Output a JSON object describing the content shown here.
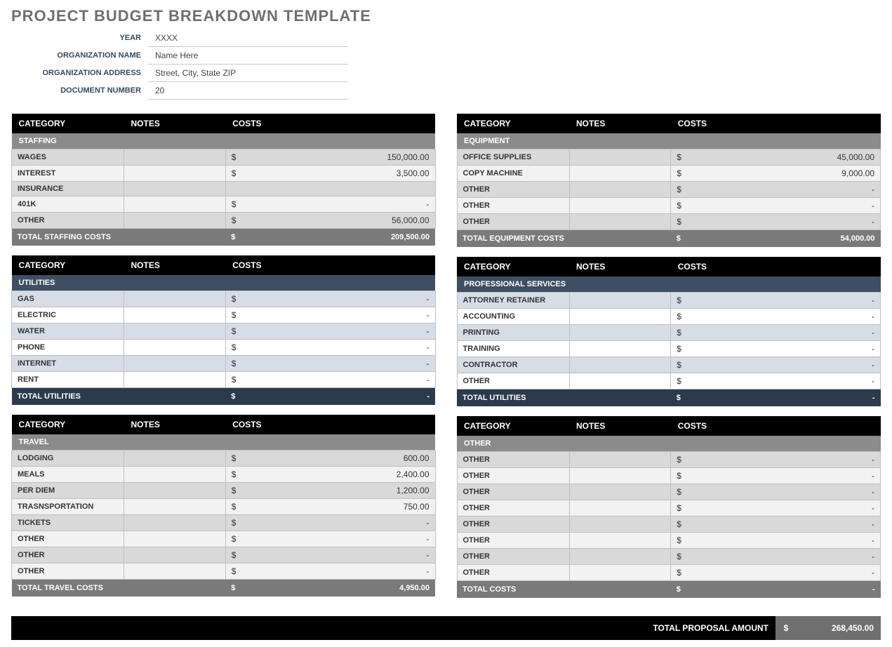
{
  "title": "PROJECT BUDGET BREAKDOWN TEMPLATE",
  "meta": {
    "year_label": "YEAR",
    "year_value": "XXXX",
    "org_name_label": "ORGANIZATION NAME",
    "org_name_value": "Name Here",
    "org_addr_label": "ORGANIZATION ADDRESS",
    "org_addr_value": "Street, City, State ZIP",
    "doc_num_label": "DOCUMENT NUMBER",
    "doc_num_value": "20"
  },
  "headers": {
    "category": "CATEGORY",
    "notes": "NOTES",
    "costs": "COSTS"
  },
  "currency": "$",
  "left": [
    {
      "style": "grey",
      "section": "STAFFING",
      "rows": [
        {
          "cat": "WAGES",
          "notes": "",
          "amt": "150,000.00"
        },
        {
          "cat": "INTEREST",
          "notes": "",
          "amt": "3,500.00"
        },
        {
          "cat": "INSURANCE",
          "notes": "",
          "amt": ""
        },
        {
          "cat": "401K",
          "notes": "",
          "amt": "-"
        },
        {
          "cat": "OTHER",
          "notes": "",
          "amt": "56,000.00"
        }
      ],
      "total_label": "TOTAL STAFFING COSTS",
      "total_amt": "209,500.00"
    },
    {
      "style": "blue",
      "section": "UTILITIES",
      "rows": [
        {
          "cat": "GAS",
          "notes": "",
          "amt": "-"
        },
        {
          "cat": "ELECTRIC",
          "notes": "",
          "amt": "-"
        },
        {
          "cat": "WATER",
          "notes": "",
          "amt": "-"
        },
        {
          "cat": "PHONE",
          "notes": "",
          "amt": "-"
        },
        {
          "cat": "INTERNET",
          "notes": "",
          "amt": "-"
        },
        {
          "cat": "RENT",
          "notes": "",
          "amt": "-"
        }
      ],
      "total_label": "TOTAL UTILITIES",
      "total_amt": "-"
    },
    {
      "style": "grey",
      "section": "TRAVEL",
      "rows": [
        {
          "cat": "LODGING",
          "notes": "",
          "amt": "600.00"
        },
        {
          "cat": "MEALS",
          "notes": "",
          "amt": "2,400.00"
        },
        {
          "cat": "PER DIEM",
          "notes": "",
          "amt": "1,200.00"
        },
        {
          "cat": "TRASNSPORTATION",
          "notes": "",
          "amt": "750.00"
        },
        {
          "cat": "TICKETS",
          "notes": "",
          "amt": "-"
        },
        {
          "cat": "OTHER",
          "notes": "",
          "amt": "-"
        },
        {
          "cat": "OTHER",
          "notes": "",
          "amt": "-"
        },
        {
          "cat": "OTHER",
          "notes": "",
          "amt": "-"
        }
      ],
      "total_label": "TOTAL TRAVEL COSTS",
      "total_amt": "4,950.00"
    }
  ],
  "right": [
    {
      "style": "grey",
      "section": "EQUIPMENT",
      "rows": [
        {
          "cat": "OFFICE SUPPLIES",
          "notes": "",
          "amt": "45,000.00"
        },
        {
          "cat": "COPY MACHINE",
          "notes": "",
          "amt": "9,000.00"
        },
        {
          "cat": "OTHER",
          "notes": "",
          "amt": "-"
        },
        {
          "cat": "OTHER",
          "notes": "",
          "amt": "-"
        },
        {
          "cat": "OTHER",
          "notes": "",
          "amt": "-"
        }
      ],
      "total_label": "TOTAL EQUIPMENT COSTS",
      "total_amt": "54,000.00"
    },
    {
      "style": "blue",
      "section": "PROFESSIONAL SERVICES",
      "rows": [
        {
          "cat": "ATTORNEY RETAINER",
          "notes": "",
          "amt": "-"
        },
        {
          "cat": "ACCOUNTING",
          "notes": "",
          "amt": "-"
        },
        {
          "cat": "PRINTING",
          "notes": "",
          "amt": "-"
        },
        {
          "cat": "TRAINING",
          "notes": "",
          "amt": "-"
        },
        {
          "cat": "CONTRACTOR",
          "notes": "",
          "amt": "-"
        },
        {
          "cat": "OTHER",
          "notes": "",
          "amt": "-"
        }
      ],
      "total_label": "TOTAL UTILITIES",
      "total_amt": "-"
    },
    {
      "style": "grey",
      "section": "OTHER",
      "rows": [
        {
          "cat": "OTHER",
          "notes": "",
          "amt": "-"
        },
        {
          "cat": "OTHER",
          "notes": "",
          "amt": "-"
        },
        {
          "cat": "OTHER",
          "notes": "",
          "amt": "-"
        },
        {
          "cat": "OTHER",
          "notes": "",
          "amt": "-"
        },
        {
          "cat": "OTHER",
          "notes": "",
          "amt": "-"
        },
        {
          "cat": "OTHER",
          "notes": "",
          "amt": "-"
        },
        {
          "cat": "OTHER",
          "notes": "",
          "amt": "-"
        },
        {
          "cat": "OTHER",
          "notes": "",
          "amt": "-"
        }
      ],
      "total_label": "TOTAL COSTS",
      "total_amt": "-"
    }
  ],
  "proposal": {
    "label": "TOTAL PROPOSAL AMOUNT",
    "amt": "268,450.00"
  }
}
